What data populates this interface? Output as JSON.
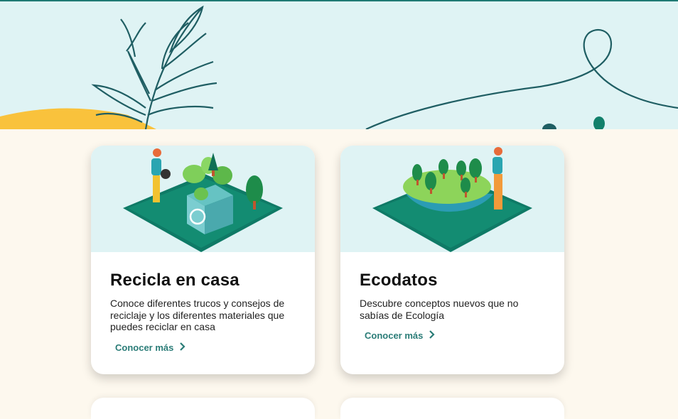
{
  "cards": [
    {
      "title": "Recicla en casa",
      "description": "Conoce diferentes trucos y consejos de reciclaje y los diferentes materiales que puedes reciclar en casa",
      "link": "Conocer más"
    },
    {
      "title": "Ecodatos",
      "description": "Descubre conceptos nuevos que no sabías de Ecología",
      "link": "Conocer más"
    }
  ],
  "colors": {
    "hero_bg": "#dff3f4",
    "page_bg": "#fdf8ee",
    "accent": "#2a7c77",
    "leaf_stroke": "#1f5e63",
    "sun": "#f9c23c"
  },
  "icons": [
    "leaf-line-illustration",
    "chevron-right-icon"
  ]
}
